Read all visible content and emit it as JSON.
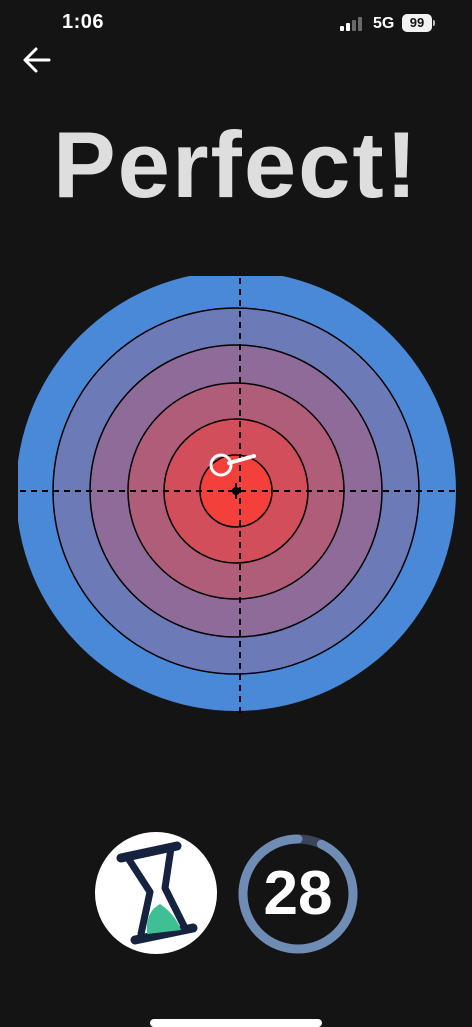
{
  "status_bar": {
    "time": "1:06",
    "network": "5G",
    "battery": "99",
    "signal_bars_active": 2,
    "signal_bars_total": 4
  },
  "header": {
    "back_icon": "arrow-left-icon"
  },
  "result": {
    "title": "Perfect!"
  },
  "target": {
    "ring_count": 6,
    "outer_color": "#4a88d8",
    "inner_color": "#f3403a",
    "line_color": "#000000",
    "marker_color": "#ffffff"
  },
  "controls": {
    "hourglass_icon": "hourglass-icon",
    "hourglass_accent": "#3fbf94",
    "hourglass_frame": "#16233f"
  },
  "timer": {
    "value": "28",
    "ring_color": "#6f8cb4",
    "remaining_fraction": 0.93
  },
  "colors": {
    "background": "#141414",
    "title": "#dedede"
  }
}
